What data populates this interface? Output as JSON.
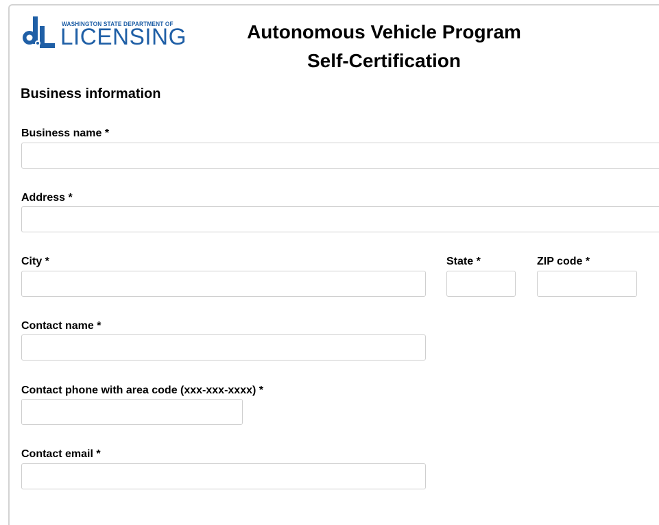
{
  "header": {
    "logo": {
      "agency_line": "WASHINGTON STATE DEPARTMENT OF",
      "wordmark": "LICENSING",
      "brand_color": "#1f5fa6",
      "icon": "dol-logo-icon"
    },
    "title_line1": "Autonomous Vehicle Program",
    "title_line2": "Self-Certification"
  },
  "section": {
    "heading": "Business information"
  },
  "fields": {
    "business_name": {
      "label": "Business name *",
      "value": ""
    },
    "address": {
      "label": "Address *",
      "value": ""
    },
    "city": {
      "label": "City *",
      "value": ""
    },
    "state": {
      "label": "State *",
      "value": ""
    },
    "zip": {
      "label": "ZIP code *",
      "value": ""
    },
    "contact_name": {
      "label": "Contact name *",
      "value": ""
    },
    "contact_phone": {
      "label": "Contact phone with area code (xxx-xxx-xxxx) *",
      "value": ""
    },
    "contact_email": {
      "label": "Contact email *",
      "value": ""
    }
  }
}
